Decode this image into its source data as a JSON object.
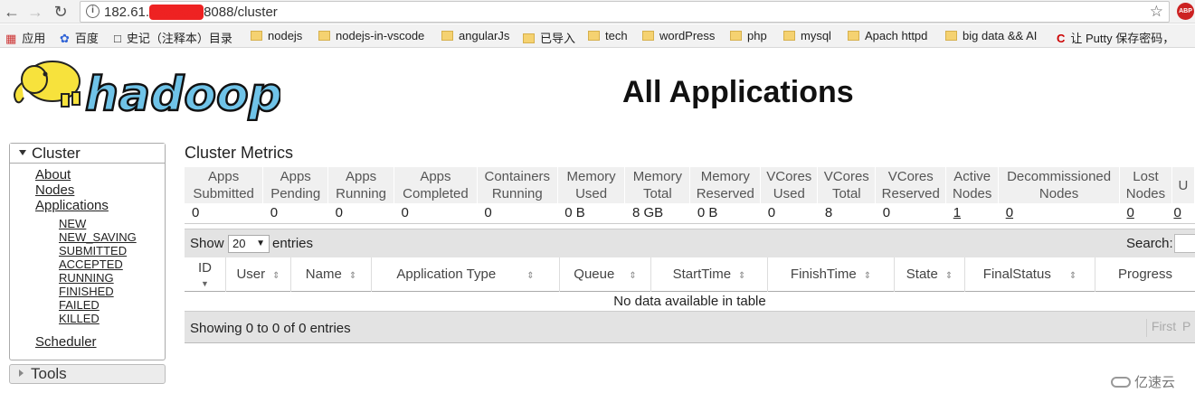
{
  "browser": {
    "url_prefix": "182.61.",
    "url_suffix": "8088/cluster",
    "abp_label": "ABP"
  },
  "bookmarks": [
    {
      "label": "应用",
      "icon": "apps-grid-icon"
    },
    {
      "label": "百度",
      "icon": "baidu-paw-icon"
    },
    {
      "label": "史记（注释本）目录",
      "icon": "page-icon"
    },
    {
      "label": "nodejs",
      "icon": "folder-icon"
    },
    {
      "label": "nodejs-in-vscode",
      "icon": "folder-icon"
    },
    {
      "label": "angularJs",
      "icon": "folder-icon"
    },
    {
      "label": "已导入",
      "icon": "folder-icon"
    },
    {
      "label": "tech",
      "icon": "folder-icon"
    },
    {
      "label": "wordPress",
      "icon": "folder-icon"
    },
    {
      "label": "php",
      "icon": "folder-icon"
    },
    {
      "label": "mysql",
      "icon": "folder-icon"
    },
    {
      "label": "Apach httpd",
      "icon": "folder-icon"
    },
    {
      "label": "big data && AI",
      "icon": "folder-icon"
    },
    {
      "label": "让 Putty 保存密码，",
      "icon": "csdn-icon"
    }
  ],
  "header": {
    "logo_text": "hadoop",
    "title": "All Applications"
  },
  "sidebar": {
    "cluster_label": "Cluster",
    "links": [
      "About",
      "Nodes",
      "Applications"
    ],
    "app_states": [
      "NEW",
      "NEW_SAVING",
      "SUBMITTED",
      "ACCEPTED",
      "RUNNING",
      "FINISHED",
      "FAILED",
      "KILLED"
    ],
    "scheduler": "Scheduler",
    "tools_label": "Tools"
  },
  "metrics": {
    "title": "Cluster Metrics",
    "headers": [
      [
        "Apps",
        "Submitted"
      ],
      [
        "Apps",
        "Pending"
      ],
      [
        "Apps",
        "Running"
      ],
      [
        "Apps",
        "Completed"
      ],
      [
        "Containers",
        "Running"
      ],
      [
        "Memory",
        "Used"
      ],
      [
        "Memory",
        "Total"
      ],
      [
        "Memory",
        "Reserved"
      ],
      [
        "VCores",
        "Used"
      ],
      [
        "VCores",
        "Total"
      ],
      [
        "VCores",
        "Reserved"
      ],
      [
        "Active",
        "Nodes"
      ],
      [
        "Decommissioned",
        "Nodes"
      ],
      [
        "Lost",
        "Nodes"
      ],
      [
        "U",
        ""
      ]
    ],
    "values": [
      "0",
      "0",
      "0",
      "0",
      "0",
      "0 B",
      "8 GB",
      "0 B",
      "0",
      "8",
      "0",
      "1",
      "0",
      "0",
      "0"
    ]
  },
  "apps_table": {
    "show_label": "Show",
    "page_size": "20",
    "entries_label": "entries",
    "search_label": "Search:",
    "columns": [
      "ID",
      "User",
      "Name",
      "Application Type",
      "Queue",
      "StartTime",
      "FinishTime",
      "State",
      "FinalStatus",
      "Progress"
    ],
    "empty_message": "No data available in table",
    "showing": "Showing 0 to 0 of 0 entries",
    "first_label": "First",
    "prev_label": "P"
  },
  "watermark": "亿速云"
}
